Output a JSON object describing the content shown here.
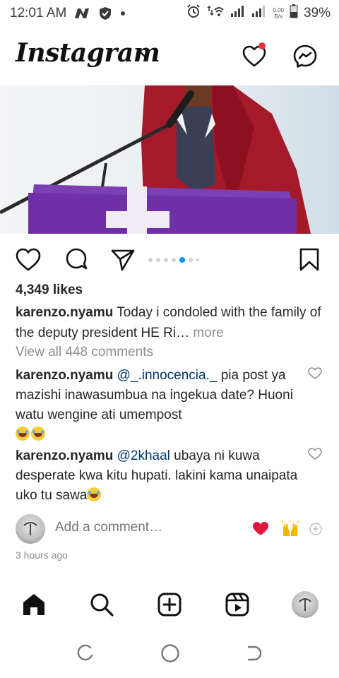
{
  "status_bar": {
    "time": "12:01 AM",
    "net_speed_value": "0.00",
    "net_speed_unit": "B/s",
    "battery": "39%"
  },
  "header": {
    "logo": "Instagram"
  },
  "post": {
    "carousel_index": 5,
    "carousel_count": 7,
    "likes": "4,349 likes",
    "caption_user": "karenzo.nyamu",
    "caption_text": " Today i condoled with the family of the deputy president HE Ri…",
    "caption_more": " more",
    "view_all_comments": "View all 448 comments",
    "comments": [
      {
        "user": "karenzo.nyamu",
        "mention": "@_.innocencia._",
        "text": " pia post ya mazishi inawasumbua na ingekua date? Huoni watu wengine ati umempost"
      },
      {
        "user": "karenzo.nyamu",
        "mention": "@2khaal",
        "text": " ubaya ni kuwa desperate kwa kitu hupati. lakini kama unaipata uko tu sawa"
      }
    ],
    "add_comment_placeholder": "Add a comment…",
    "timestamp": "3 hours ago"
  },
  "colors": {
    "accent_blue": "#0095f6",
    "notification_red": "#ed3237",
    "mention": "#00376b",
    "secondary_text": "#8e8e8e"
  },
  "icons": {
    "header": [
      "chevron-down-icon",
      "heart-icon",
      "messenger-icon"
    ],
    "actions": [
      "like-icon",
      "comment-icon",
      "share-icon",
      "save-icon"
    ],
    "quick_reactions": [
      "red-heart-emoji",
      "raised-hands-emoji",
      "add-reaction-icon"
    ],
    "bottom_nav": [
      "home-icon",
      "search-icon",
      "create-icon",
      "reels-icon",
      "profile-avatar"
    ]
  }
}
